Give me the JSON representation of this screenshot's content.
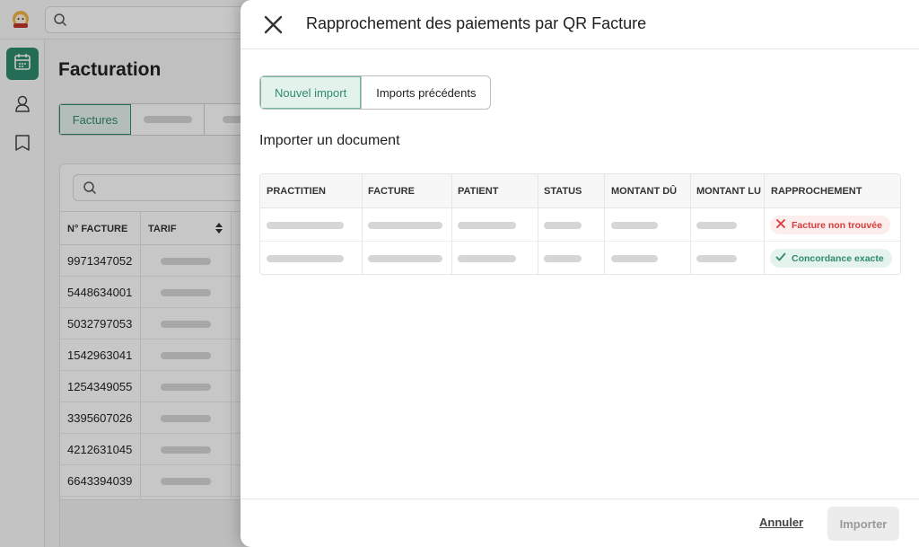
{
  "modal": {
    "title": "Rapprochement des paiements par QR Facture",
    "tabs": [
      {
        "label": "Nouvel import",
        "active": true
      },
      {
        "label": "Imports précédents",
        "active": false
      }
    ],
    "section_title": "Importer un document",
    "table": {
      "headers": [
        "PRACTITIEN",
        "FACTURE",
        "PATIENT",
        "STATUS",
        "MONTANT DÛ",
        "MONTANT LU",
        "RAPPROCHEMENT"
      ],
      "rows": [
        {
          "rapprochement": "Facture non trouvée",
          "status_type": "error",
          "icon": "x-icon"
        },
        {
          "rapprochement": "Concordance exacte",
          "status_type": "success",
          "icon": "check-icon"
        }
      ]
    },
    "footer": {
      "cancel_label": "Annuler",
      "import_label": "Importer"
    }
  },
  "background": {
    "page_title": "Facturation",
    "tabs": [
      {
        "label": "Factures",
        "active": true
      }
    ],
    "table_headers": [
      "N° FACTURE",
      "TARIF"
    ],
    "invoice_numbers": [
      "9971347052",
      "5448634001",
      "5032797053",
      "1542963041",
      "1254349055",
      "3395607026",
      "4212631045",
      "6643394039"
    ],
    "sidebar_icons": [
      "calendar-icon",
      "user-icon",
      "book-icon"
    ]
  },
  "colors": {
    "accent": "#2e8b6f",
    "error": "#d83a3a",
    "accent_bg": "#e4f2ec"
  }
}
